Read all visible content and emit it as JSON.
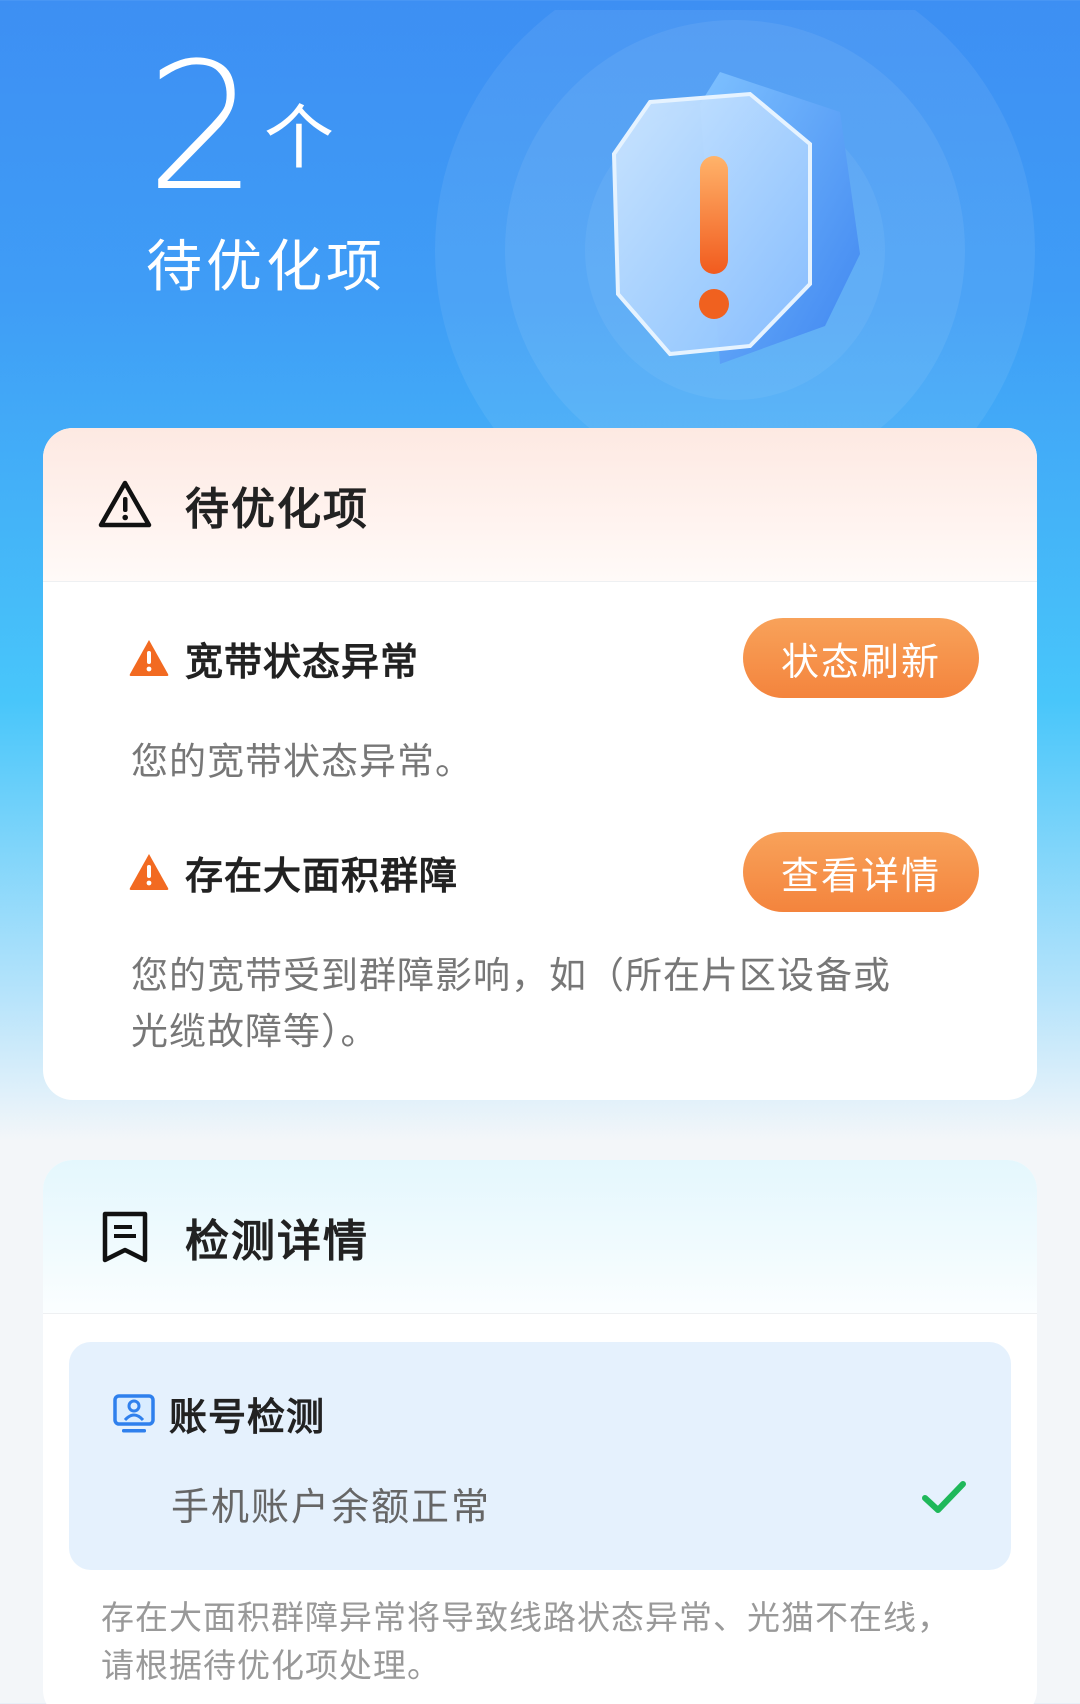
{
  "header": {
    "count": "2",
    "unit": "个",
    "label": "待优化项",
    "hero_icon": "warning-shield-icon"
  },
  "optimize_card": {
    "title": "待优化项",
    "icon": "warning-triangle-outline-icon",
    "items": [
      {
        "title": "宽带状态异常",
        "desc": "您的宽带状态异常。",
        "button": "状态刷新",
        "icon": "warning-triangle-filled-icon"
      },
      {
        "title": "存在大面积群障",
        "desc": "您的宽带受到群障影响，如（所在片区设备或光缆故障等）。",
        "button": "查看详情",
        "icon": "warning-triangle-filled-icon"
      }
    ]
  },
  "detail_card": {
    "title": "检测详情",
    "icon": "document-report-icon",
    "items": [
      {
        "title": "账号检测",
        "status": "手机账户余额正常",
        "icon": "account-monitor-icon",
        "status_icon": "check-icon"
      }
    ],
    "note": "存在大面积群障异常将导致线路状态异常、光猫不在线，请根据待优化项处理。"
  },
  "colors": {
    "accent_orange": "#f4843d",
    "warning_orange": "#f26a21",
    "success_green": "#1fb85a",
    "header_blue": "#3d8ff3"
  }
}
